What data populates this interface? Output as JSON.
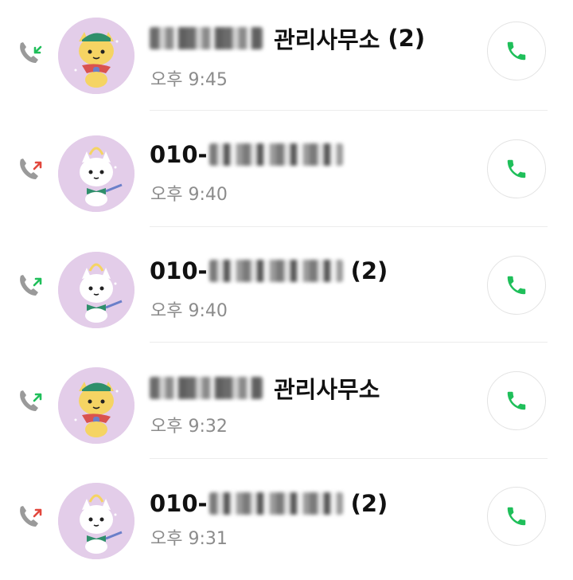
{
  "colors": {
    "accent_green": "#1fbf5a",
    "missed_red": "#e2473d",
    "phone_gray": "#9a9a9a",
    "avatar_bg": "#e3cde9"
  },
  "calls": [
    {
      "direction": "incoming",
      "direction_icon": "incoming-call-icon",
      "avatar": "yellow-cat-character",
      "name_prefix": "",
      "name_suffix": "관리사무소",
      "count": "(2)",
      "time": "오후 9:45"
    },
    {
      "direction": "outgoing",
      "direction_icon": "outgoing-call-icon",
      "avatar": "white-cat-character",
      "name_prefix": "010-",
      "name_suffix": "",
      "count": "",
      "time": "오후 9:40"
    },
    {
      "direction": "outgoing",
      "direction_icon": "outgoing-call-icon",
      "avatar": "white-cat-character",
      "name_prefix": "010-",
      "name_suffix": "",
      "count": "(2)",
      "time": "오후 9:40"
    },
    {
      "direction": "outgoing",
      "direction_icon": "outgoing-call-icon",
      "avatar": "yellow-cat-character",
      "name_prefix": "",
      "name_suffix": "관리사무소",
      "count": "",
      "time": "오후 9:32"
    },
    {
      "direction": "outgoing",
      "direction_icon": "outgoing-call-icon",
      "avatar": "white-cat-character",
      "name_prefix": "010-",
      "name_suffix": "",
      "count": "(2)",
      "time": "오후 9:31"
    }
  ]
}
